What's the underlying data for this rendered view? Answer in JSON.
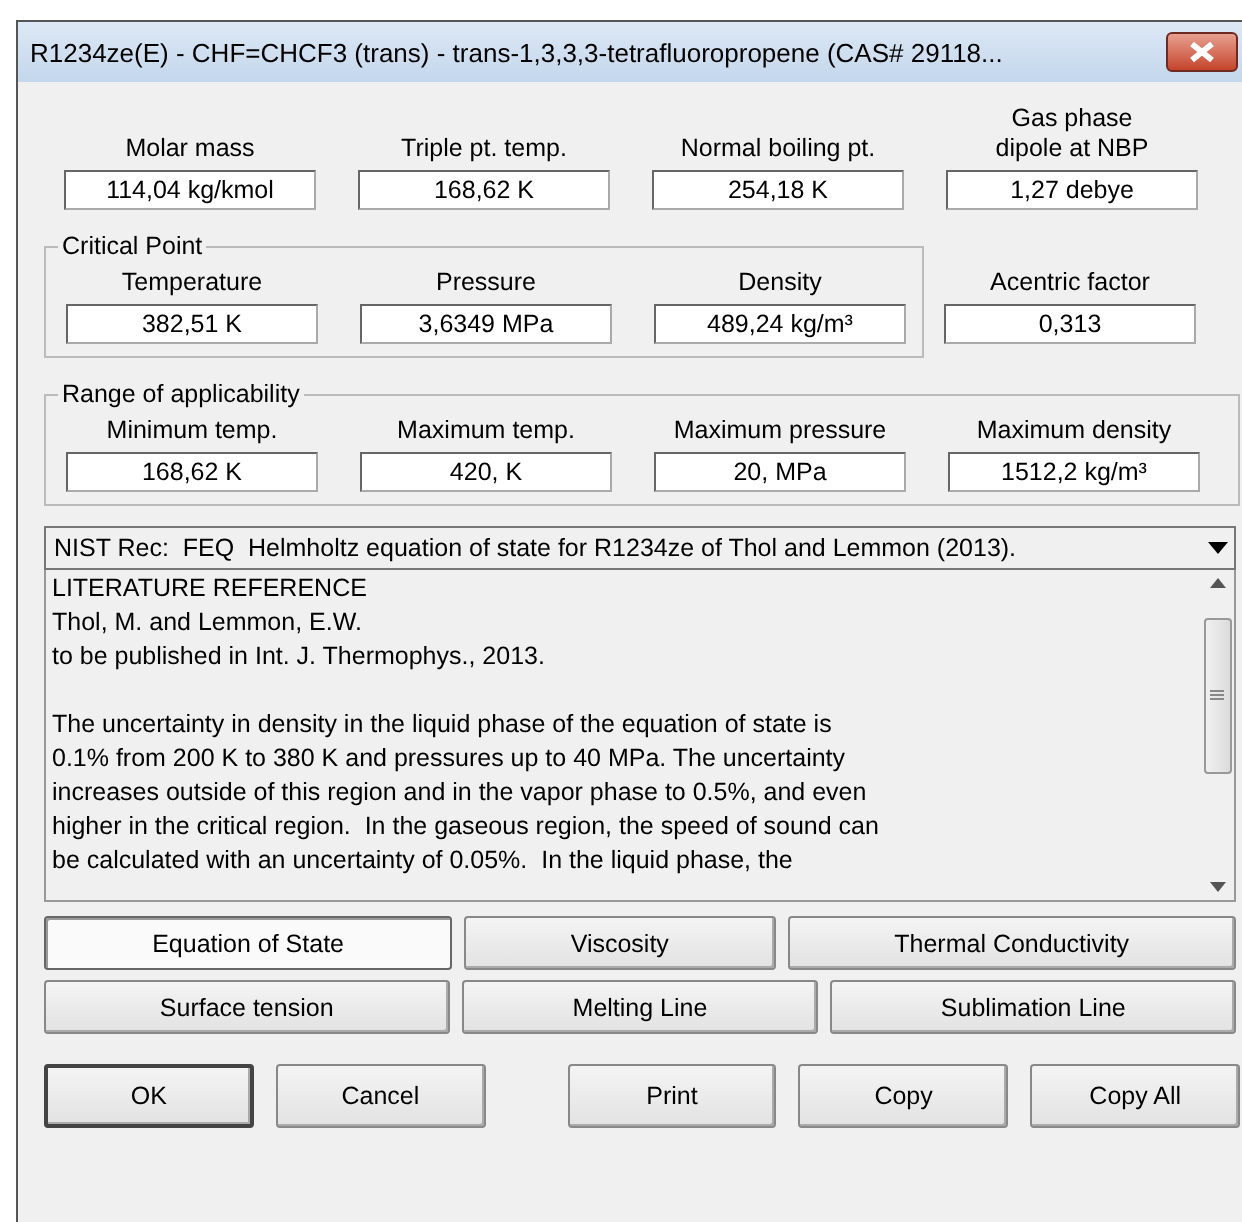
{
  "window": {
    "title": "R1234ze(E) - CHF=CHCF3 (trans) - trans-1,3,3,3-tetrafluoropropene (CAS# 29118..."
  },
  "properties": [
    {
      "label": "Molar mass",
      "value": "114,04 kg/kmol"
    },
    {
      "label": "Triple pt. temp.",
      "value": "168,62 K"
    },
    {
      "label": "Normal boiling pt.",
      "value": "254,18 K"
    },
    {
      "label": "Gas phase\ndipole at NBP",
      "value": "1,27 debye"
    }
  ],
  "critical_point": {
    "title": "Critical Point",
    "fields": [
      {
        "label": "Temperature",
        "value": "382,51 K"
      },
      {
        "label": "Pressure",
        "value": "3,6349 MPa"
      },
      {
        "label": "Density",
        "value": "489,24 kg/m³"
      }
    ]
  },
  "acentric_factor": {
    "label": "Acentric factor",
    "value": "0,313"
  },
  "range": {
    "title": "Range of applicability",
    "fields": [
      {
        "label": "Minimum temp.",
        "value": "168,62 K"
      },
      {
        "label": "Maximum temp.",
        "value": "420, K"
      },
      {
        "label": "Maximum pressure",
        "value": "20, MPa"
      },
      {
        "label": "Maximum density",
        "value": "1512,2 kg/m³"
      }
    ]
  },
  "model_select": {
    "value": "NIST Rec:  FEQ  Helmholtz equation of state for R1234ze of Thol and Lemmon (2013)."
  },
  "reference_text": [
    [
      "LITERATURE REFERENCE",
      "Thol, M. and Lemmon, E.W.",
      "to be published in Int. J. Thermophys., 2013."
    ],
    [
      "The uncertainty in density in the liquid phase of the equation of state is",
      "0.1% from 200 K to 380 K and pressures up to 40 MPa. The uncertainty",
      "increases outside of this region and in the vapor phase to 0.5%, and even",
      "higher in the critical region.  In the gaseous region, the speed of sound can",
      "be calculated with an uncertainty of 0.05%.  In the liquid phase, the"
    ]
  ],
  "model_buttons": [
    [
      {
        "label": "Equation of State",
        "selected": true
      },
      {
        "label": "Viscosity",
        "selected": false
      },
      {
        "label": "Thermal Conductivity",
        "selected": false
      }
    ],
    [
      {
        "label": "Surface tension",
        "selected": false
      },
      {
        "label": "Melting Line",
        "selected": false
      },
      {
        "label": "Sublimation Line",
        "selected": false
      }
    ]
  ],
  "buttons": [
    {
      "label": "OK",
      "default": true
    },
    {
      "label": "Cancel",
      "default": false
    },
    {
      "label": "Print",
      "default": false
    },
    {
      "label": "Copy",
      "default": false
    },
    {
      "label": "Copy All",
      "default": false
    }
  ]
}
